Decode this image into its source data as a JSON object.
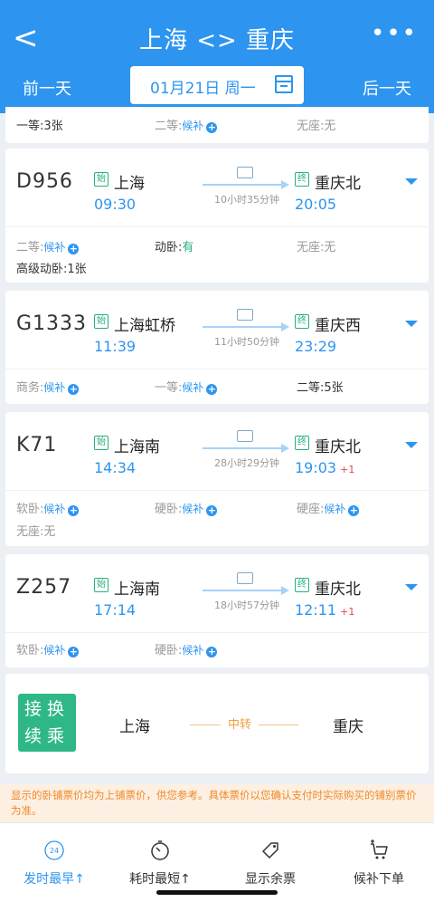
{
  "header": {
    "back": "<",
    "title": "上海 <> 重庆",
    "more": "•••",
    "prev_day": "前一天",
    "next_day": "后一天",
    "date": "01月21日 周一"
  },
  "partial_card": {
    "seats": [
      {
        "label": "一等:",
        "value": "3张",
        "type": "count"
      },
      {
        "label": "二等:",
        "value": "候补",
        "type": "houbu"
      },
      {
        "label": "无座:",
        "value": "无",
        "type": "none"
      }
    ]
  },
  "trains": [
    {
      "no": "D956",
      "from_badge": "始",
      "from": "上海",
      "dep": "09:30",
      "duration": "10小时35分钟",
      "to_badge": "终",
      "to": "重庆北",
      "arr": "20:05",
      "plus": "",
      "seats": [
        {
          "label": "二等:",
          "value": "候补",
          "type": "houbu"
        },
        {
          "label": "动卧:",
          "value": "有",
          "type": "have"
        },
        {
          "label": "无座:",
          "value": "无",
          "type": "none"
        },
        {
          "label": "高级动卧:",
          "value": "1张",
          "type": "count"
        }
      ]
    },
    {
      "no": "G1333",
      "from_badge": "始",
      "from": "上海虹桥",
      "dep": "11:39",
      "duration": "11小时50分钟",
      "to_badge": "终",
      "to": "重庆西",
      "arr": "23:29",
      "plus": "",
      "seats": [
        {
          "label": "商务:",
          "value": "候补",
          "type": "houbu"
        },
        {
          "label": "一等:",
          "value": "候补",
          "type": "houbu"
        },
        {
          "label": "二等:",
          "value": "5张",
          "type": "count"
        }
      ]
    },
    {
      "no": "K71",
      "from_badge": "始",
      "from": "上海南",
      "dep": "14:34",
      "duration": "28小时29分钟",
      "to_badge": "终",
      "to": "重庆北",
      "arr": "19:03",
      "plus": "+1",
      "seats": [
        {
          "label": "软卧:",
          "value": "候补",
          "type": "houbu"
        },
        {
          "label": "硬卧:",
          "value": "候补",
          "type": "houbu"
        },
        {
          "label": "硬座:",
          "value": "候补",
          "type": "houbu"
        },
        {
          "label": "无座:",
          "value": "无",
          "type": "none"
        }
      ]
    },
    {
      "no": "Z257",
      "from_badge": "始",
      "from": "上海南",
      "dep": "17:14",
      "duration": "18小时57分钟",
      "to_badge": "终",
      "to": "重庆北",
      "arr": "12:11",
      "plus": "+1",
      "seats": [
        {
          "label": "软卧:",
          "value": "候补",
          "type": "houbu"
        },
        {
          "label": "硬卧:",
          "value": "候补",
          "type": "houbu"
        }
      ]
    }
  ],
  "transfer": {
    "button_line1": "接换",
    "button_line2": "续乘",
    "from": "上海",
    "mid": "中转",
    "to": "重庆"
  },
  "notice": "显示的卧铺票价均为上铺票价，供您参考。具体票价以您确认支付时实际购买的铺别票价为准。",
  "bottom": {
    "items": [
      {
        "label": "发时最早↑",
        "icon": "clock-24-icon",
        "active": true
      },
      {
        "label": "耗时最短↑",
        "icon": "stopwatch-icon",
        "active": false
      },
      {
        "label": "显示余票",
        "icon": "ticket-tag-icon",
        "active": false
      },
      {
        "label": "候补下单",
        "icon": "cart-add-icon",
        "active": false
      }
    ],
    "clock_text": "24"
  },
  "colors": {
    "primary": "#2d95f0",
    "green": "#27b07a",
    "orange": "#f08a27",
    "red": "#e84545"
  }
}
